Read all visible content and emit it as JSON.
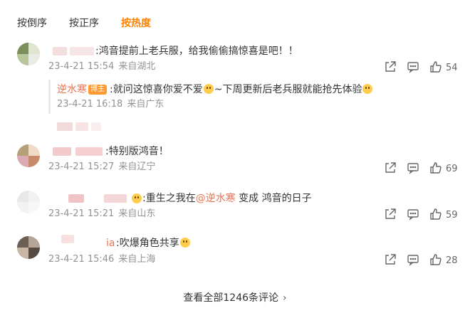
{
  "tabs": [
    {
      "label": "按倒序",
      "active": false
    },
    {
      "label": "按正序",
      "active": false
    },
    {
      "label": "按热度",
      "active": true
    }
  ],
  "colors": {
    "accent": "#ff8200",
    "link": "#eb7350",
    "meta": "#939393",
    "badge": "#ff9a2e"
  },
  "comments": [
    {
      "text": ":鸿音提前上老兵服，给我偷偷搞惊喜是吧！！",
      "time": "23-4-21 15:54",
      "location": "来自湖北",
      "likes": "54",
      "reply": {
        "author": "逆水寒",
        "badge": "博主",
        "text_a": ":就问这惊喜你爱不爱",
        "text_b": "~下周更新后老兵服就能抢先体验",
        "time": "23-4-21 16:18",
        "location": "来自广东"
      }
    },
    {
      "text": ":特别版鸿音！",
      "time": "23-4-21 15:27",
      "location": "来自辽宁",
      "likes": "69"
    },
    {
      "text_a": ":重生之我在",
      "mention": "@逆水寒",
      "text_b": " 变成 鸿音的日子",
      "time": "23-4-21 15:21",
      "location": "来自山东",
      "likes": "59"
    },
    {
      "name_tail": "ia",
      "text": ":吹爆角色共享",
      "time": "23-4-21 15:46",
      "location": "来自上海",
      "likes": "28"
    }
  ],
  "icons": {
    "share": "share-icon",
    "comment": "comment-icon",
    "like": "thumbs-up-icon",
    "more": "chevron-right-icon"
  },
  "footer": {
    "view_all": "查看全部1246条评论"
  }
}
